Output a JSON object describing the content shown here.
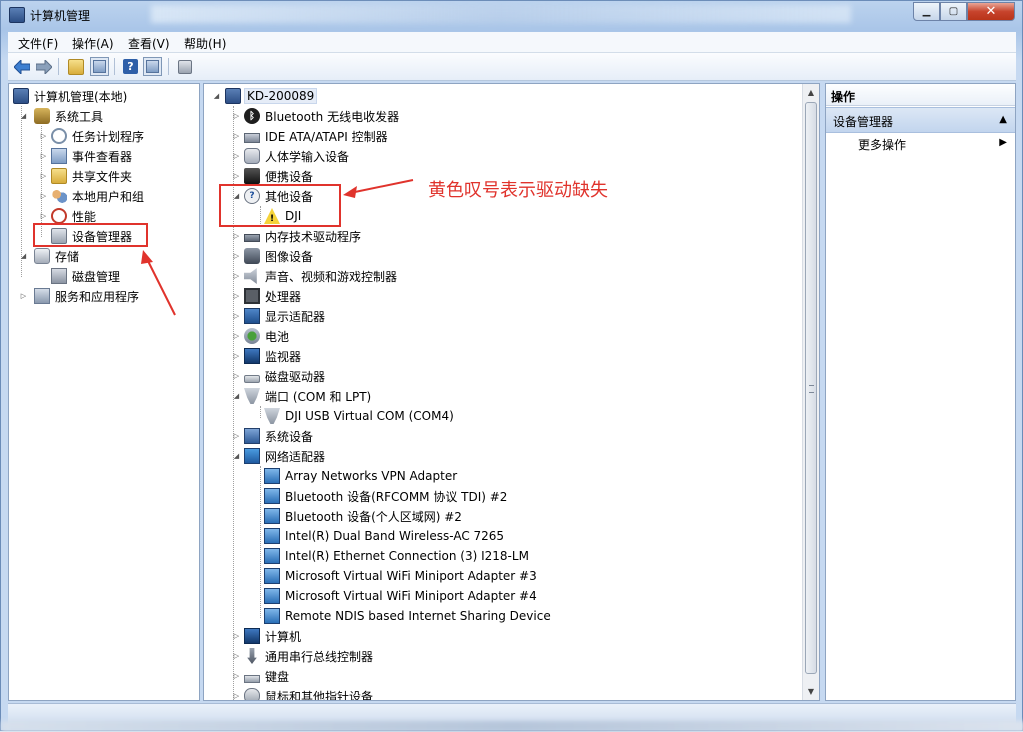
{
  "window": {
    "title": "计算机管理"
  },
  "menu": [
    "文件(F)",
    "操作(A)",
    "查看(V)",
    "帮助(H)"
  ],
  "left_tree": {
    "root": "计算机管理(本地)",
    "system_tools": "系统工具",
    "system_children": [
      "任务计划程序",
      "事件查看器",
      "共享文件夹",
      "本地用户和组",
      "性能",
      "设备管理器"
    ],
    "storage": "存储",
    "storage_children": [
      "磁盘管理"
    ],
    "services": "服务和应用程序"
  },
  "device_tree": {
    "computer": "KD-200089",
    "categories": {
      "bluetooth": "Bluetooth 无线电收发器",
      "ide": "IDE ATA/ATAPI 控制器",
      "hid": "人体学输入设备",
      "portable": "便携设备",
      "other": "其他设备",
      "other_child": "DJI",
      "memory": "内存技术驱动程序",
      "imaging": "图像设备",
      "sound": "声音、视频和游戏控制器",
      "processor": "处理器",
      "display": "显示适配器",
      "battery": "电池",
      "monitor": "监视器",
      "disk": "磁盘驱动器",
      "ports": "端口 (COM 和 LPT)",
      "ports_child": "DJI USB Virtual COM (COM4)",
      "system": "系统设备",
      "network": "网络适配器",
      "network_children": [
        "Array Networks VPN Adapter",
        "Bluetooth 设备(RFCOMM 协议 TDI) #2",
        "Bluetooth 设备(个人区域网) #2",
        "Intel(R) Dual Band Wireless-AC 7265",
        "Intel(R) Ethernet Connection (3) I218-LM",
        "Microsoft Virtual WiFi Miniport Adapter #3",
        "Microsoft Virtual WiFi Miniport Adapter #4",
        "Remote NDIS based Internet Sharing Device"
      ],
      "computer_node": "计算机",
      "usb": "通用串行总线控制器",
      "keyboard": "键盘",
      "mouse": "鼠标和其他指针设备"
    }
  },
  "actions_pane": {
    "header": "操作",
    "section": "设备管理器",
    "more": "更多操作"
  },
  "annotation": {
    "text": "黄色叹号表示驱动缺失",
    "color": "#e0332c"
  }
}
